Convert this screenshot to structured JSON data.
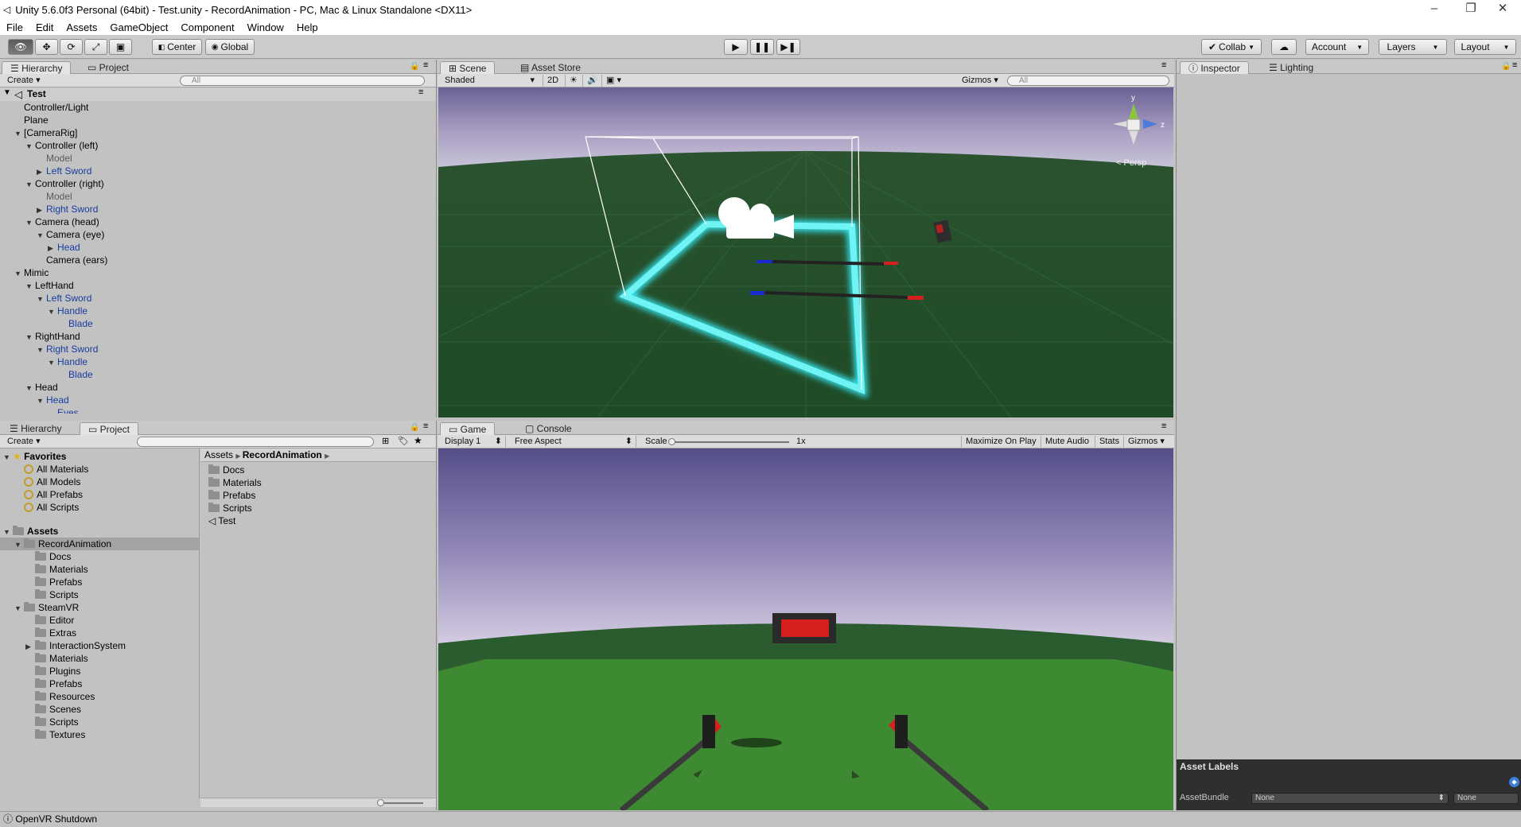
{
  "window": {
    "title": "Unity 5.6.0f3 Personal (64bit) - Test.unity - RecordAnimation - PC, Mac & Linux Standalone <DX11>",
    "controls": [
      "–",
      "❐",
      "✕"
    ]
  },
  "menu": [
    "File",
    "Edit",
    "Assets",
    "GameObject",
    "Component",
    "Window",
    "Help"
  ],
  "toolbar": {
    "pivot": "Center",
    "space": "Global",
    "collab": "Collab",
    "account": "Account",
    "layers": "Layers",
    "layout": "Layout"
  },
  "hierarchy": {
    "tabs": [
      "Hierarchy",
      "Project"
    ],
    "create": "Create",
    "search_placeholder": "All",
    "scene": "Test",
    "items": [
      {
        "label": "Controller/Light",
        "depth": 1,
        "arrow": "",
        "color": "normal"
      },
      {
        "label": "Plane",
        "depth": 1,
        "arrow": "",
        "color": "normal"
      },
      {
        "label": "[CameraRig]",
        "depth": 1,
        "arrow": "▼",
        "color": "normal"
      },
      {
        "label": "Controller (left)",
        "depth": 2,
        "arrow": "▼",
        "color": "normal"
      },
      {
        "label": "Model",
        "depth": 3,
        "arrow": "",
        "color": "gray"
      },
      {
        "label": "Left Sword",
        "depth": 3,
        "arrow": "▶",
        "color": "blue"
      },
      {
        "label": "Controller (right)",
        "depth": 2,
        "arrow": "▼",
        "color": "normal"
      },
      {
        "label": "Model",
        "depth": 3,
        "arrow": "",
        "color": "gray"
      },
      {
        "label": "Right Sword",
        "depth": 3,
        "arrow": "▶",
        "color": "blue"
      },
      {
        "label": "Camera (head)",
        "depth": 2,
        "arrow": "▼",
        "color": "normal"
      },
      {
        "label": "Camera (eye)",
        "depth": 3,
        "arrow": "▼",
        "color": "normal"
      },
      {
        "label": "Head",
        "depth": 4,
        "arrow": "▶",
        "color": "blue"
      },
      {
        "label": "Camera (ears)",
        "depth": 3,
        "arrow": "",
        "color": "normal"
      },
      {
        "label": "Mimic",
        "depth": 1,
        "arrow": "▼",
        "color": "normal"
      },
      {
        "label": "LeftHand",
        "depth": 2,
        "arrow": "▼",
        "color": "normal"
      },
      {
        "label": "Left Sword",
        "depth": 3,
        "arrow": "▼",
        "color": "blue"
      },
      {
        "label": "Handle",
        "depth": 4,
        "arrow": "▼",
        "color": "blue"
      },
      {
        "label": "Blade",
        "depth": 5,
        "arrow": "",
        "color": "blue"
      },
      {
        "label": "RightHand",
        "depth": 2,
        "arrow": "▼",
        "color": "normal"
      },
      {
        "label": "Right Sword",
        "depth": 3,
        "arrow": "▼",
        "color": "blue"
      },
      {
        "label": "Handle",
        "depth": 4,
        "arrow": "▼",
        "color": "blue"
      },
      {
        "label": "Blade",
        "depth": 5,
        "arrow": "",
        "color": "blue"
      },
      {
        "label": "Head",
        "depth": 2,
        "arrow": "▼",
        "color": "normal"
      },
      {
        "label": "Head",
        "depth": 3,
        "arrow": "▼",
        "color": "blue"
      },
      {
        "label": "Eyes",
        "depth": 4,
        "arrow": "",
        "color": "blue"
      }
    ]
  },
  "project": {
    "tabs": [
      "Hierarchy",
      "Project"
    ],
    "create": "Create",
    "favorites_label": "Favorites",
    "favorites": [
      "All Materials",
      "All Models",
      "All Prefabs",
      "All Scripts"
    ],
    "assets_label": "Assets",
    "tree": [
      {
        "label": "RecordAnimation",
        "depth": 1,
        "arrow": "▼",
        "selected": true
      },
      {
        "label": "Docs",
        "depth": 2,
        "arrow": ""
      },
      {
        "label": "Materials",
        "depth": 2,
        "arrow": ""
      },
      {
        "label": "Prefabs",
        "depth": 2,
        "arrow": ""
      },
      {
        "label": "Scripts",
        "depth": 2,
        "arrow": ""
      },
      {
        "label": "SteamVR",
        "depth": 1,
        "arrow": "▼"
      },
      {
        "label": "Editor",
        "depth": 2,
        "arrow": ""
      },
      {
        "label": "Extras",
        "depth": 2,
        "arrow": ""
      },
      {
        "label": "InteractionSystem",
        "depth": 2,
        "arrow": "▶"
      },
      {
        "label": "Materials",
        "depth": 2,
        "arrow": ""
      },
      {
        "label": "Plugins",
        "depth": 2,
        "arrow": ""
      },
      {
        "label": "Prefabs",
        "depth": 2,
        "arrow": ""
      },
      {
        "label": "Resources",
        "depth": 2,
        "arrow": ""
      },
      {
        "label": "Scenes",
        "depth": 2,
        "arrow": ""
      },
      {
        "label": "Scripts",
        "depth": 2,
        "arrow": ""
      },
      {
        "label": "Textures",
        "depth": 2,
        "arrow": ""
      }
    ],
    "breadcrumb_root": "Assets",
    "breadcrumb_current": "RecordAnimation",
    "contents": [
      {
        "label": "Docs",
        "kind": "folder"
      },
      {
        "label": "Materials",
        "kind": "folder"
      },
      {
        "label": "Prefabs",
        "kind": "folder"
      },
      {
        "label": "Scripts",
        "kind": "folder"
      },
      {
        "label": "Test",
        "kind": "scene"
      }
    ]
  },
  "scene": {
    "tabs": [
      "Scene",
      "Asset Store"
    ],
    "shading": "Shaded",
    "mode_2d": "2D",
    "gizmos": "Gizmos",
    "search_placeholder": "All",
    "persp": "Persp",
    "axis_y": "y",
    "axis_z": "z"
  },
  "game": {
    "tabs": [
      "Game",
      "Console"
    ],
    "display": "Display 1",
    "aspect": "Free Aspect",
    "scale_label": "Scale",
    "scale_value": "1x",
    "maximize": "Maximize On Play",
    "mute": "Mute Audio",
    "stats": "Stats",
    "gizmos": "Gizmos"
  },
  "inspector": {
    "tabs": [
      "Inspector",
      "Lighting"
    ],
    "asset_labels": "Asset Labels",
    "asset_bundle_label": "AssetBundle",
    "asset_bundle_value": "None",
    "asset_variant_value": "None"
  },
  "status": {
    "message": "OpenVR Shutdown"
  },
  "colors": {
    "accent_blue": "#173d9e",
    "selection": "#a3a3a3",
    "scene_ground": "#1f4a26",
    "sky_top": "#585289"
  }
}
